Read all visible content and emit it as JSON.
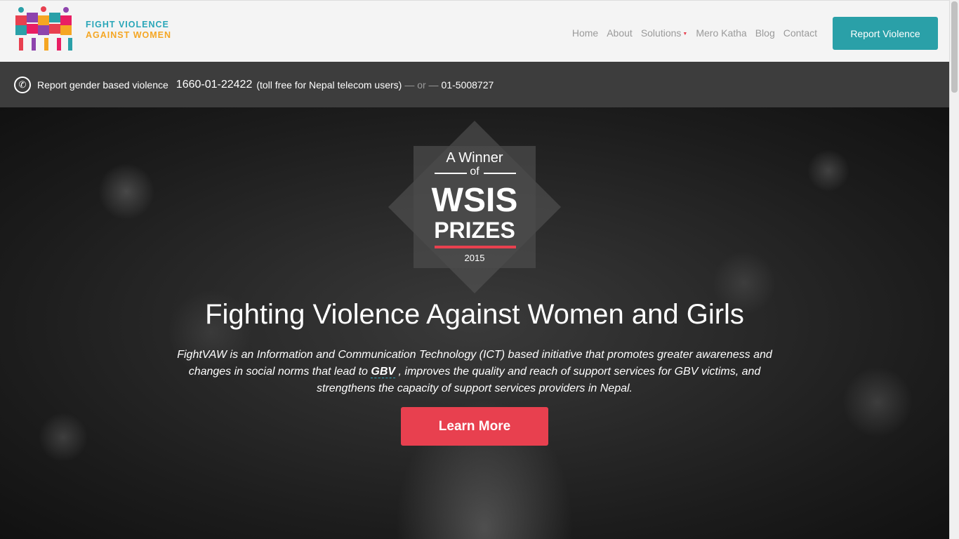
{
  "logo": {
    "line1": "FIGHT VIOLENCE",
    "line2": "AGAINST WOMEN",
    "icon": "puzzle-people-logo"
  },
  "nav": {
    "items": [
      "Home",
      "About",
      "Solutions",
      "Mero Katha",
      "Blog",
      "Contact"
    ]
  },
  "report_button": "Report Violence",
  "callbar": {
    "icon": "phone-icon",
    "label": "Report gender based violence",
    "number": "1660-01-22422",
    "note": "(toll free for Nepal telecom users)",
    "or": "— or —",
    "alt_number": "01-5008727"
  },
  "badge": {
    "line1": "A Winner",
    "line2": "of",
    "line3": "WSIS",
    "line4": "PRIZES",
    "year": "2015"
  },
  "hero": {
    "headline": "Fighting Violence Against Women and Girls",
    "desc_part1": "FightVAW is an Information and Communication Technology (ICT) based initiative that promotes greater awareness and changes in social norms that lead to",
    "desc_abbr": "GBV",
    "desc_part2": ", improves the quality and reach of support services for GBV victims, and strengthens the capacity of support services providers in Nepal.",
    "cta": "Learn More"
  },
  "colors": {
    "teal": "#2aa0a8",
    "red": "#e8404f",
    "orange": "#f5a623",
    "dark_bar": "#3d3d3d"
  }
}
